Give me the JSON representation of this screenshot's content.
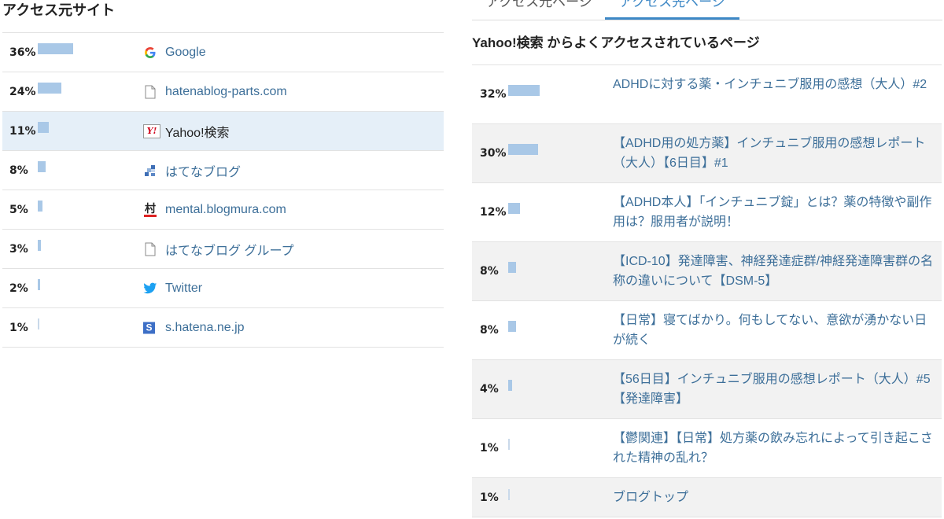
{
  "left": {
    "title": "アクセス元サイト",
    "rows": [
      {
        "pct": "36%",
        "ratio": 0.36,
        "icon": "google-icon",
        "label": "Google"
      },
      {
        "pct": "24%",
        "ratio": 0.24,
        "icon": "page-icon",
        "label": "hatenablog-parts.com"
      },
      {
        "pct": "11%",
        "ratio": 0.11,
        "icon": "yahoo-icon",
        "label": "Yahoo!検索",
        "active": true
      },
      {
        "pct": "8%",
        "ratio": 0.08,
        "icon": "hatenablog-icon",
        "label": "はてなブログ"
      },
      {
        "pct": "5%",
        "ratio": 0.05,
        "icon": "blogmura-icon",
        "label": "mental.blogmura.com"
      },
      {
        "pct": "3%",
        "ratio": 0.03,
        "icon": "page-icon",
        "label": "はてなブログ グループ"
      },
      {
        "pct": "2%",
        "ratio": 0.02,
        "icon": "twitter-icon",
        "label": "Twitter"
      },
      {
        "pct": "1%",
        "ratio": 0.01,
        "icon": "hatena-s-icon",
        "label": "s.hatena.ne.jp"
      }
    ]
  },
  "right": {
    "tabs": [
      {
        "label": "アクセス元ページ",
        "active": false
      },
      {
        "label": "アクセス先ページ",
        "active": true
      }
    ],
    "title": "Yahoo!検索 からよくアクセスされているページ",
    "rows": [
      {
        "pct": "32%",
        "ratio": 0.32,
        "label": "ADHDに対する薬・インチュニブ服用の感想（大人）#2"
      },
      {
        "pct": "30%",
        "ratio": 0.3,
        "label": "【ADHD用の処方薬】インチュニブ服用の感想レポート（大人）【6日目】#1"
      },
      {
        "pct": "12%",
        "ratio": 0.12,
        "label": "【ADHD本人】「インチュニブ錠」とは？薬の特徴や副作用は？服用者が説明！"
      },
      {
        "pct": "8%",
        "ratio": 0.08,
        "label": "【ICD-10】発達障害、神経発達症群/神経発達障害群の名称の違いについて【DSM-5】"
      },
      {
        "pct": "8%",
        "ratio": 0.08,
        "label": "【日常】寝てばかり。何もしてない、意欲が湧かない日が続く"
      },
      {
        "pct": "4%",
        "ratio": 0.04,
        "label": "【56日目】インチュニブ服用の感想レポート（大人）#5【発達障害】"
      },
      {
        "pct": "1%",
        "ratio": 0.01,
        "label": "【鬱関連】【日常】処方薬の飲み忘れによって引き起こされた精神の乱れ？"
      },
      {
        "pct": "1%",
        "ratio": 0.01,
        "label": "ブログトップ"
      }
    ]
  },
  "colors": {
    "bar": "#a9c8e7",
    "link": "#3d6f99",
    "tab_active": "#3d88c6",
    "row_active": "#e5eff8"
  },
  "icons": {
    "yahoo_text": "Y!",
    "blogmura_text": "村",
    "hatena_s_text": "S"
  }
}
